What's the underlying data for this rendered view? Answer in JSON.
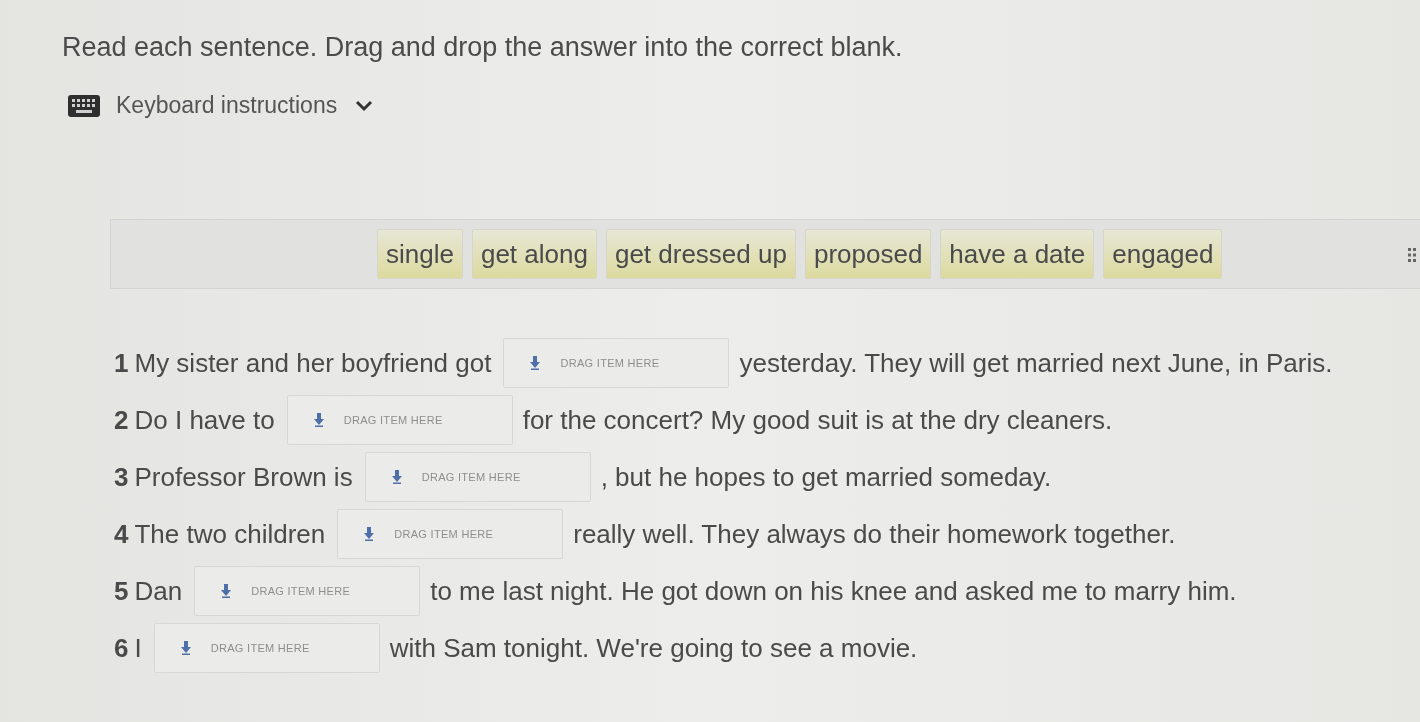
{
  "instructions": "Read each sentence. Drag and drop the answer into the correct blank.",
  "keyboard_instructions": {
    "label": "Keyboard instructions",
    "expanded": false
  },
  "answer_bank": {
    "tiles": [
      {
        "label": "single"
      },
      {
        "label": "get along"
      },
      {
        "label": "get dressed up"
      },
      {
        "label": "proposed"
      },
      {
        "label": "have a date"
      },
      {
        "label": "engaged"
      }
    ]
  },
  "questions": [
    {
      "number": "1",
      "before": "My sister and her boyfriend got",
      "blank": {
        "placeholder": "DRAG ITEM HERE"
      },
      "after": "yesterday. They will get married next June, in Paris."
    },
    {
      "number": "2",
      "before": "Do I have to",
      "blank": {
        "placeholder": "DRAG ITEM HERE"
      },
      "after": "for the concert? My good suit is at the dry cleaners."
    },
    {
      "number": "3",
      "before": "Professor Brown is",
      "blank": {
        "placeholder": "DRAG ITEM HERE"
      },
      "after": ", but he hopes to get married someday."
    },
    {
      "number": "4",
      "before": "The two children",
      "blank": {
        "placeholder": "DRAG ITEM HERE"
      },
      "after": "really well. They always do their homework together."
    },
    {
      "number": "5",
      "before": "Dan",
      "blank": {
        "placeholder": "DRAG ITEM HERE"
      },
      "after": "to me last night. He got down on his knee and asked me to marry him."
    },
    {
      "number": "6",
      "before": "I",
      "blank": {
        "placeholder": "DRAG ITEM HERE"
      },
      "after": "with Sam tonight. We're going to see a movie."
    }
  ]
}
